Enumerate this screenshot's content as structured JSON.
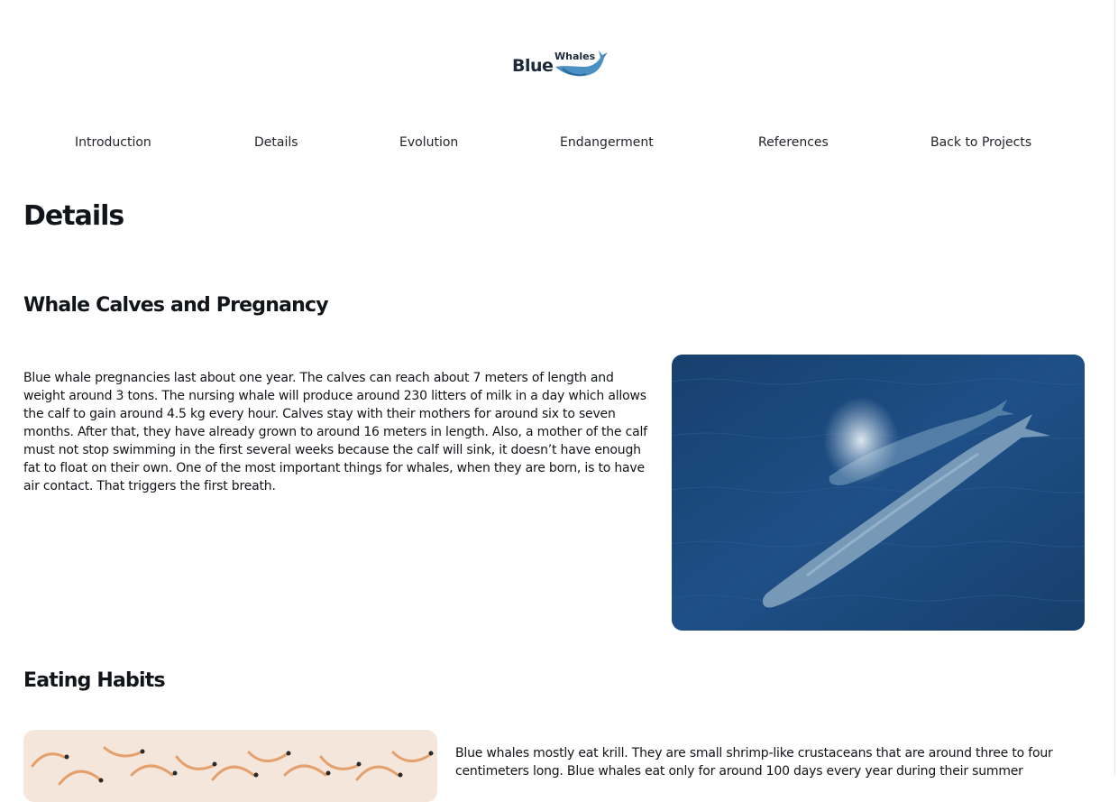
{
  "logo": {
    "word1": "Blue",
    "word2": "Whales",
    "icon": "whale-icon"
  },
  "nav": {
    "items": [
      {
        "label": "Introduction"
      },
      {
        "label": "Details"
      },
      {
        "label": "Evolution"
      },
      {
        "label": "Endangerment"
      },
      {
        "label": "References"
      },
      {
        "label": "Back to Projects"
      }
    ]
  },
  "main": {
    "title": "Details",
    "sections": [
      {
        "heading": "Whale Calves and Pregnancy",
        "text": "Blue whale pregnancies last about one year. The calves can reach about 7 meters of length and weight around 3 tons. The nursing whale will produce around 230 litters of milk in a day which allows the calf to gain around 4.5 kg every hour. Calves stay with their mothers for around six to seven months. After that, they have already grown to around 16 meters in length. Also, a mother of the calf must not stop swimming in the first several weeks because the calf will sink, it doesn’t have enough fat to float on their own. One of the most important things for whales, when they are born, is to have air contact. That triggers the first breath.",
        "image": "blue-whales-swimming-photo"
      },
      {
        "heading": "Eating Habits",
        "text": "Blue whales mostly eat krill. They are small shrimp-like crustaceans that are around three to four centimeters long. Blue whales eat only for around 100 days every year during their summer",
        "image": "krill-photo"
      }
    ]
  },
  "colors": {
    "text": "#111418",
    "ocean": "#1d4a7a",
    "krill": "#e8965a"
  }
}
